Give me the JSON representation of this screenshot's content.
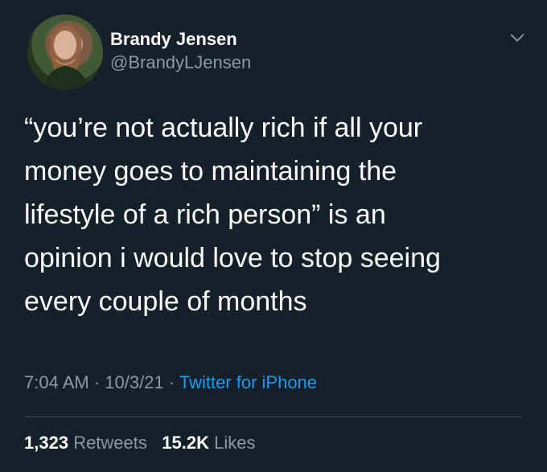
{
  "user": {
    "display_name": "Brandy Jensen",
    "handle": "@BrandyLJensen"
  },
  "tweet": {
    "text": "“you’re not actually rich if all your\nmoney goes to maintaining the\nlifestyle of a rich person” is an\nopinion i would love to stop seeing\nevery couple of months",
    "time": "7:04 AM",
    "date": "10/3/21",
    "source": "Twitter for iPhone",
    "separator": " · "
  },
  "stats": {
    "retweets_count": "1,323",
    "retweets_label": "Retweets",
    "likes_count": "15.2K",
    "likes_label": "Likes"
  },
  "colors": {
    "background": "#15202b",
    "text_primary": "#ffffff",
    "text_secondary": "#8b98a5",
    "accent": "#1d9bf0",
    "divider": "#38444d"
  },
  "icons": {
    "menu": "chevron-down-icon"
  }
}
